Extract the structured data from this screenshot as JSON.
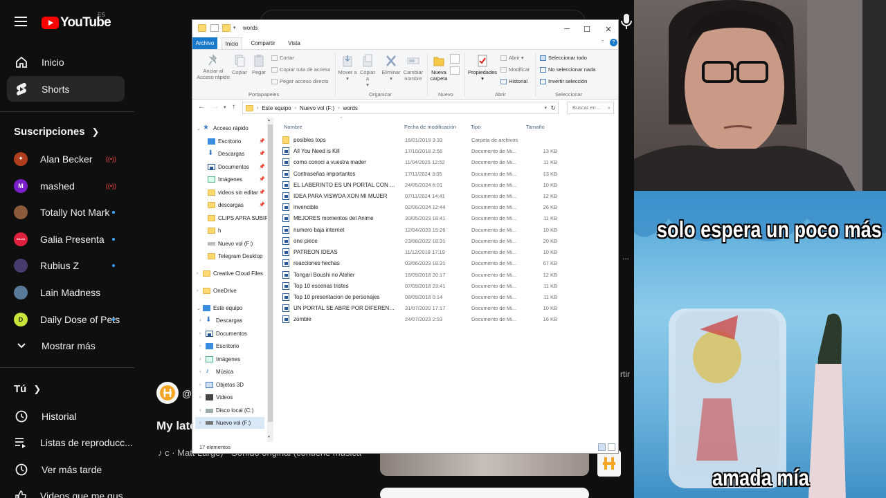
{
  "youtube": {
    "logo_text": "YouTube",
    "region": "ES",
    "nav_main": [
      {
        "label": "Inicio",
        "icon": "home-icon"
      },
      {
        "label": "Shorts",
        "icon": "shorts-icon"
      }
    ],
    "subscriptions_title": "Suscripciones",
    "subscriptions": [
      {
        "label": "Alan Becker",
        "color": "#b03d1e",
        "badge": "live"
      },
      {
        "label": "mashed",
        "color": "#7a1fc9",
        "badge": "live",
        "initial": "M"
      },
      {
        "label": "Totally Not Mark",
        "color": "#8a5a3a",
        "badge": "dot"
      },
      {
        "label": "Galia Presenta",
        "color": "#e0213e",
        "badge": "dot",
        "initial": "GALIA"
      },
      {
        "label": "Rubius Z",
        "color": "#4a3b6e",
        "badge": "dot"
      },
      {
        "label": "Lain Madness",
        "color": "#5a7a9a",
        "badge": "none"
      },
      {
        "label": "Daily Dose of Pets",
        "color": "#c8e53a",
        "badge": "dot"
      }
    ],
    "show_more": "Mostrar más",
    "you_title": "Tú",
    "you_items": [
      {
        "label": "Historial",
        "icon": "history-icon"
      },
      {
        "label": "Listas de reproducc...",
        "icon": "playlists-icon"
      },
      {
        "label": "Ver más tarde",
        "icon": "watch-later-icon"
      },
      {
        "label": "Videos que me gus...",
        "icon": "liked-icon"
      }
    ],
    "channel_at": "@",
    "video_title": "My late",
    "video_sub": "♪ c · Matt Large) · Sonido original (contiene música",
    "side_fragment_1": "...",
    "side_fragment_2": "rtir"
  },
  "meme": {
    "top_text": "solo espera un poco más",
    "bottom_text": "amada mía"
  },
  "explorer": {
    "title": "words",
    "tabs": {
      "file": "Archivo",
      "home": "Inicio",
      "share": "Compartir",
      "view": "Vista"
    },
    "ribbon": {
      "pin": "Anclar al Acceso rápido",
      "copy": "Copiar",
      "paste": "Pegar",
      "cut": "Cortar",
      "copy_path": "Copiar ruta de acceso",
      "paste_shortcut": "Pegar acceso directo",
      "group_clipboard": "Portapapeles",
      "move_to": "Mover a",
      "copy_to": "Copiar a",
      "delete": "Eliminar",
      "rename": "Cambiar nombre",
      "group_organize": "Organizar",
      "new_folder": "Nueva carpeta",
      "group_new": "Nuevo",
      "properties": "Propiedades",
      "open": "Abrir",
      "edit": "Modificar",
      "history": "Historial",
      "group_open": "Abrir",
      "select_all": "Seleccionar todo",
      "select_none": "No seleccionar nada",
      "invert_selection": "Invertir selección",
      "group_select": "Seleccionar"
    },
    "breadcrumb": [
      "Este equipo",
      "Nuevo vol (F:)",
      "words"
    ],
    "search_placeholder": "Buscar en ...",
    "nav_pane": {
      "quick_access": "Acceso rápido",
      "quick_items": [
        "Escritorio",
        "Descargas",
        "Documentos",
        "Imágenes",
        "videos sin editar",
        "descargas",
        "CLIPS APRA SUBIR",
        "h",
        "Nuevo vol (F:)",
        "Telegram Desktop"
      ],
      "creative_cloud": "Creative Cloud Files",
      "onedrive": "OneDrive",
      "this_pc": "Este equipo",
      "pc_items": [
        "Descargas",
        "Documentos",
        "Escritorio",
        "Imágenes",
        "Música",
        "Objetos 3D",
        "Videos",
        "Disco local (C:)",
        "Nuevo vol (F:)"
      ]
    },
    "columns": {
      "name": "Nombre",
      "date": "Fecha de modificación",
      "type": "Tipo",
      "size": "Tamaño"
    },
    "files": [
      {
        "name": "posibles tops",
        "date": "16/01/2019 3:33",
        "type": "Carpeta de archivos",
        "size": "",
        "kind": "folder"
      },
      {
        "name": "All You Need is Kill",
        "date": "17/10/2018 2:56",
        "type": "Documento de Mi...",
        "size": "13 KB",
        "kind": "doc"
      },
      {
        "name": "como conoci a vuestra mader",
        "date": "11/04/2025 12:52",
        "type": "Documento de Mi...",
        "size": "11 KB",
        "kind": "doc"
      },
      {
        "name": "Contraseñas importantes",
        "date": "17/11/2024 3:05",
        "type": "Documento de Mi...",
        "size": "13 KB",
        "kind": "doc"
      },
      {
        "name": "EL LABERINTO ES UN PORTAL  CON NIVE...",
        "date": "24/05/2024 6:01",
        "type": "Documento de Mi...",
        "size": "10 KB",
        "kind": "doc"
      },
      {
        "name": "IDEA PARA VISWOA XON MI MUJER",
        "date": "07/11/2024 14:41",
        "type": "Documento de Mi...",
        "size": "12 KB",
        "kind": "doc"
      },
      {
        "name": "invencible",
        "date": "02/06/2024 12:44",
        "type": "Documento de Mi...",
        "size": "26 KB",
        "kind": "doc"
      },
      {
        "name": "MEJORES momentos del Anime",
        "date": "30/05/2023 18:41",
        "type": "Documento de Mi...",
        "size": "11 KB",
        "kind": "doc"
      },
      {
        "name": "numero baja internet",
        "date": "12/04/2023 15:26",
        "type": "Documento de Mi...",
        "size": "10 KB",
        "kind": "doc"
      },
      {
        "name": "one piece",
        "date": "23/08/2022 18:31",
        "type": "Documento de Mi...",
        "size": "20 KB",
        "kind": "doc"
      },
      {
        "name": "PATREON IDEAS",
        "date": "11/12/2018 17:19",
        "type": "Documento de Mi...",
        "size": "10 KB",
        "kind": "doc"
      },
      {
        "name": "reacciones hechas",
        "date": "03/06/2023 18:31",
        "type": "Documento de Mi...",
        "size": "67 KB",
        "kind": "doc"
      },
      {
        "name": "Tongari Boushi no Atelier",
        "date": "16/09/2018 20:17",
        "type": "Documento de Mi...",
        "size": "12 KB",
        "kind": "doc"
      },
      {
        "name": "Top 10 escenas tristes",
        "date": "07/09/2018 23:41",
        "type": "Documento de Mi...",
        "size": "11 KB",
        "kind": "doc"
      },
      {
        "name": "Top 10 presentacion de personajes",
        "date": "08/09/2018 0:14",
        "type": "Documento de Mi...",
        "size": "11 KB",
        "kind": "doc"
      },
      {
        "name": "UN PORTAL SE ABRE POR DIFERENTES EP...",
        "date": "31/07/2020 17:17",
        "type": "Documento de Mi...",
        "size": "10 KB",
        "kind": "doc"
      },
      {
        "name": "zombie",
        "date": "24/07/2023 2:53",
        "type": "Documento de Mi...",
        "size": "16 KB",
        "kind": "doc"
      }
    ],
    "status": "17 elementos"
  }
}
